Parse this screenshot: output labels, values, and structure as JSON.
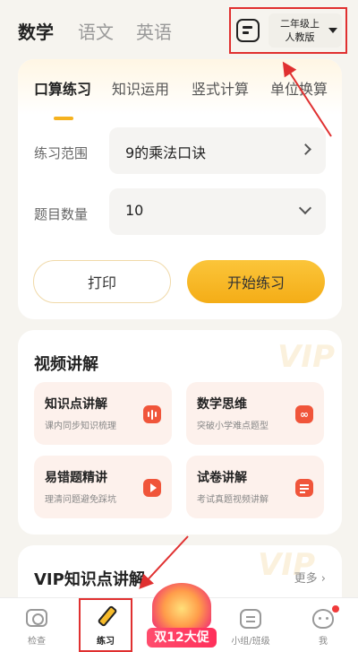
{
  "subjects": [
    "数学",
    "语文",
    "英语"
  ],
  "active_subject": "数学",
  "grade_selector": {
    "line1": "二年级上",
    "line2": "人教版"
  },
  "practice_tabs": [
    "口算练习",
    "知识运用",
    "竖式计算",
    "单位换算"
  ],
  "active_tab": "口算练习",
  "range": {
    "label": "练习范围",
    "value": "9的乘法口诀"
  },
  "count": {
    "label": "题目数量",
    "value": "10"
  },
  "buttons": {
    "print": "打印",
    "start": "开始练习"
  },
  "video": {
    "title": "视频讲解",
    "tiles": [
      {
        "title": "知识点讲解",
        "sub": "课内同步知识梳理"
      },
      {
        "title": "数学思维",
        "sub": "突破小学难点题型"
      },
      {
        "title": "易错题精讲",
        "sub": "理清问题避免踩坑"
      },
      {
        "title": "试卷讲解",
        "sub": "考试真题视频讲解"
      }
    ]
  },
  "vip": {
    "title": "VIP知识点讲解",
    "more": "更多 ›"
  },
  "tabbar": {
    "check": "检查",
    "practice": "练习",
    "promo": "双12大促",
    "group": "小组/班级",
    "me": "我"
  },
  "colors": {
    "accent": "#f5b21f",
    "highlight_box": "#e03030",
    "tile_icon": "#f0553a"
  }
}
